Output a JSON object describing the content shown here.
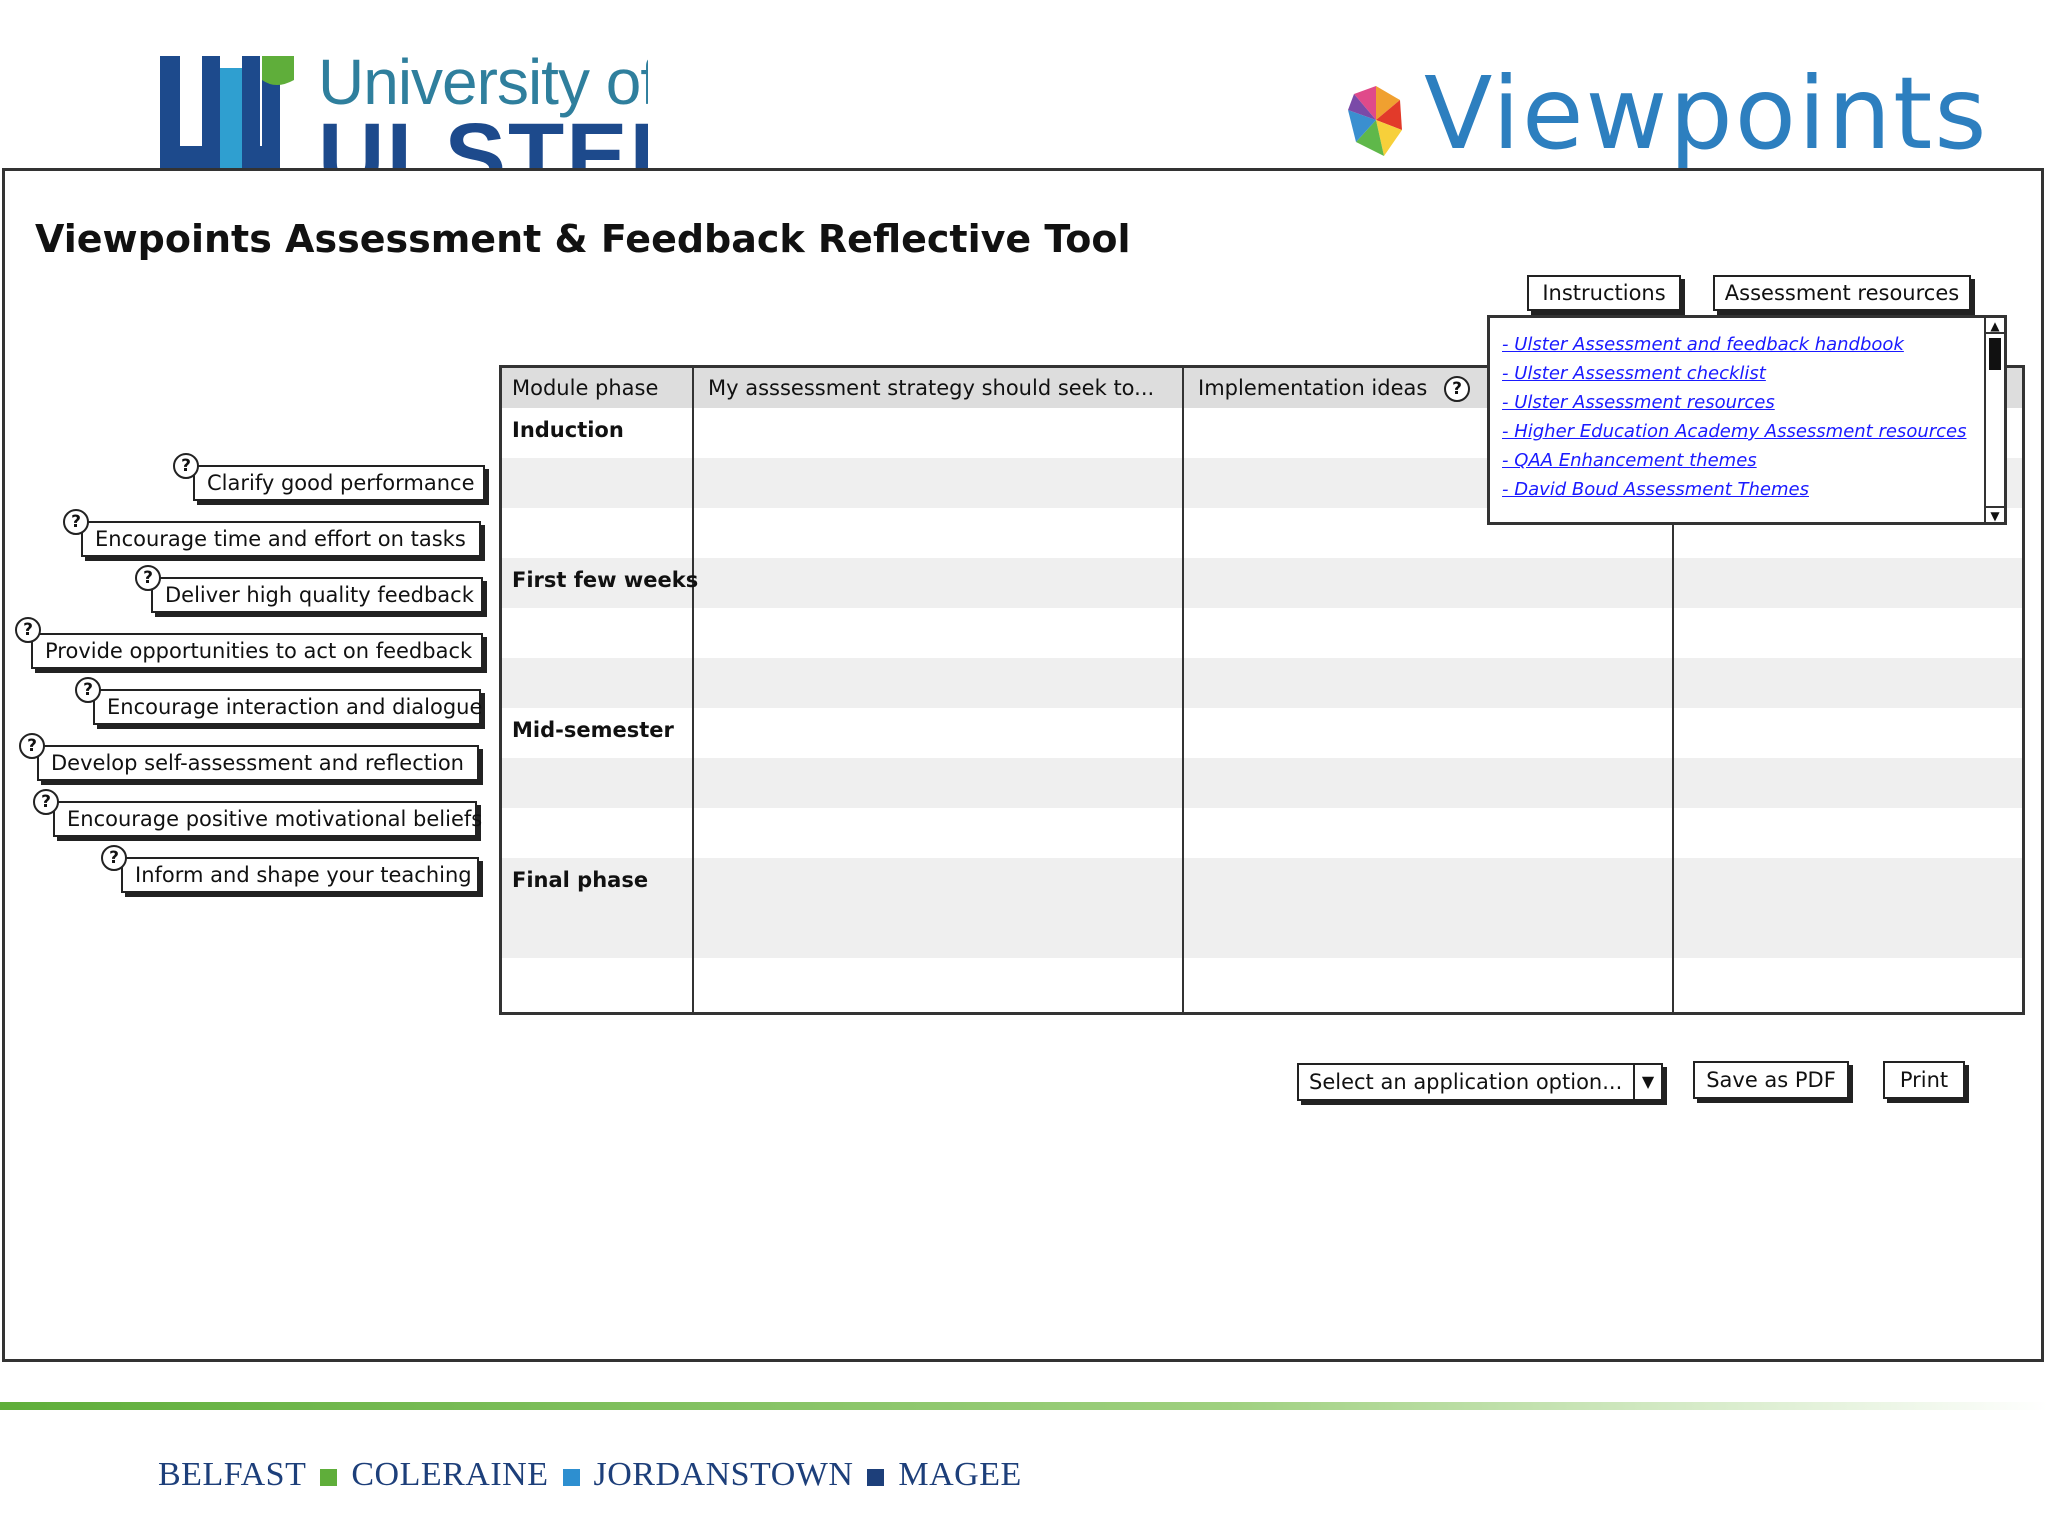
{
  "header": {
    "university_line1": "University of",
    "university_line2": "ULSTER",
    "viewpoints_brand": "Viewpoints"
  },
  "title": "Viewpoints Assessment & Feedback Reflective Tool",
  "help_glyph": "?",
  "objectives": [
    {
      "label": "Clarify good performance"
    },
    {
      "label": "Encourage time and effort on tasks"
    },
    {
      "label": "Deliver high quality feedback"
    },
    {
      "label": "Provide opportunities to act on feedback"
    },
    {
      "label": "Encourage interaction and dialogue"
    },
    {
      "label": "Develop self-assessment and reflection"
    },
    {
      "label": "Encourage positive motivational beliefs"
    },
    {
      "label": "Inform and shape your teaching"
    }
  ],
  "grid": {
    "headers": {
      "module_phase": "Module phase",
      "strategy": "My asssessment strategy should seek to...",
      "implementation": "Implementation ideas"
    },
    "phases": [
      "Induction",
      "First few weeks",
      "Mid-semester",
      "Final phase"
    ]
  },
  "tabs": {
    "instructions": "Instructions",
    "assessment_resources": "Assessment resources"
  },
  "resources": [
    "- Ulster Assessment and feedback handbook",
    "- Ulster Assessment checklist",
    "- Ulster Assessment resources",
    "- Higher Education Academy Assessment resources",
    "- QAA Enhancement themes",
    "- David Boud Assessment Themes"
  ],
  "controls": {
    "select_placeholder": "Select an application option...",
    "save_pdf": "Save as PDF",
    "print": "Print"
  },
  "footer": {
    "campuses": [
      "BELFAST",
      "COLERAINE",
      "JORDANSTOWN",
      "MAGEE"
    ],
    "square_color": "#5fae3a",
    "square_color_alt": "#2d8fd0"
  },
  "colors": {
    "link": "#1a1aff",
    "ulster_blue": "#1d4a8c",
    "viewpoints_blue": "#2d7fbf"
  }
}
